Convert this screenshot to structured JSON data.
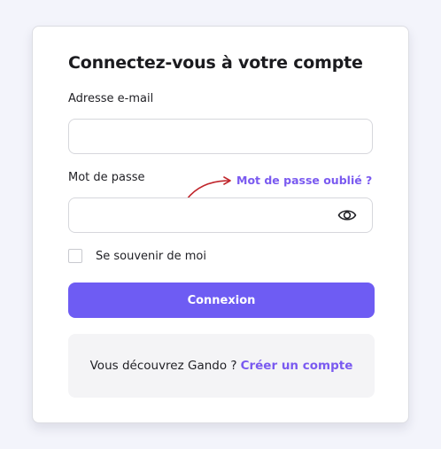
{
  "login": {
    "title": "Connectez-vous à votre compte",
    "email_label": "Adresse e-mail",
    "email_value": "",
    "password_label": "Mot de passe",
    "password_value": "",
    "forgot_link": "Mot de passe oublié ?",
    "remember_label": "Se souvenir de moi",
    "remember_checked": false,
    "submit_label": "Connexion",
    "signup_prompt": "Vous découvrez Gando ?",
    "signup_link": "Créer un compte"
  },
  "icons": {
    "password_toggle": "eye-icon",
    "annotation": "curved-arrow-icon"
  },
  "colors": {
    "accent": "#6e5cf3",
    "link": "#7a5af0",
    "annotation_arrow": "#c0262c",
    "background": "#f3f4fb"
  }
}
